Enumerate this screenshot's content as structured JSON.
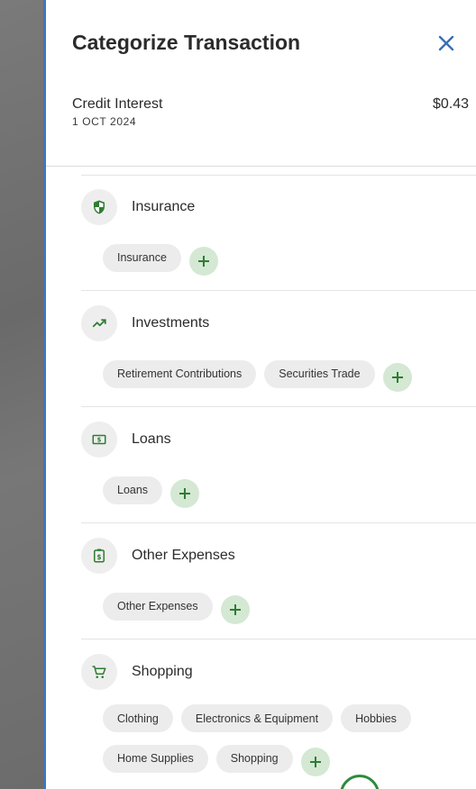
{
  "dialog": {
    "title": "Categorize Transaction",
    "close_icon": "close-icon"
  },
  "transaction": {
    "name": "Credit Interest",
    "date": "1 OCT 2024",
    "amount": "$0.43"
  },
  "colors": {
    "accent_green": "#2e7d32",
    "add_button_bg": "#d4e8d4",
    "chip_bg": "#ececec",
    "panel_edge": "#3a78c2",
    "close_icon": "#3a6fb0"
  },
  "categories": [
    {
      "label": "Insurance",
      "icon": "shield-icon",
      "chips": [
        "Insurance"
      ]
    },
    {
      "label": "Investments",
      "icon": "trending-up-icon",
      "chips": [
        "Retirement Contributions",
        "Securities Trade"
      ]
    },
    {
      "label": "Loans",
      "icon": "cash-icon",
      "chips": [
        "Loans"
      ]
    },
    {
      "label": "Other Expenses",
      "icon": "receipt-dollar-icon",
      "chips": [
        "Other Expenses"
      ]
    },
    {
      "label": "Shopping",
      "icon": "shopping-cart-icon",
      "chips": [
        "Clothing",
        "Electronics & Equipment",
        "Hobbies",
        "Home Supplies",
        "Shopping"
      ]
    }
  ]
}
